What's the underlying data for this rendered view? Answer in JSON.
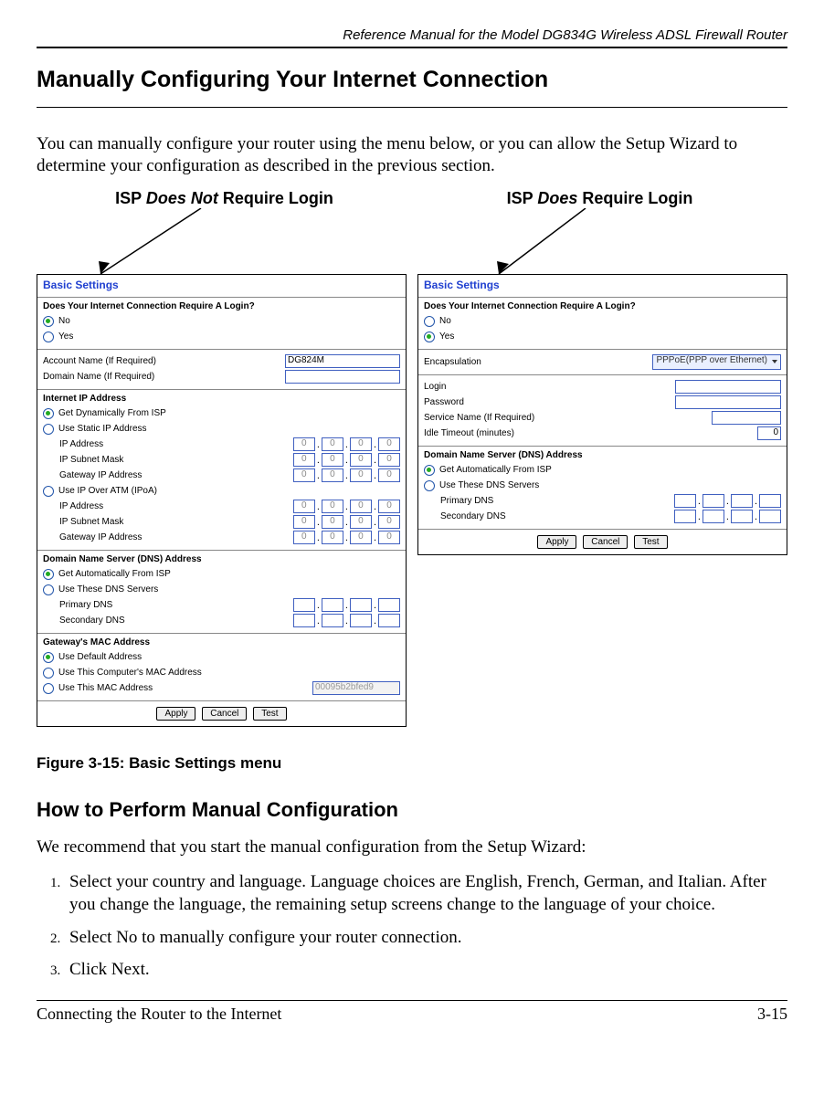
{
  "header": {
    "running_title": "Reference Manual for the Model DG834G Wireless ADSL Firewall Router"
  },
  "h1": "Manually Configuring Your Internet Connection",
  "intro": "You can manually configure your router using the menu below, or you can allow the Setup Wizard to determine your configuration as described in the previous section.",
  "callouts": {
    "left_pre": "ISP ",
    "left_em": "Does Not",
    "left_post": " Require Login",
    "right_pre": "ISP ",
    "right_em": "Does",
    "right_post": " Require Login"
  },
  "panel_left": {
    "title": "Basic Settings",
    "q": "Does Your Internet Connection Require A Login?",
    "no": "No",
    "yes": "Yes",
    "account_label": "Account Name  (If Required)",
    "account_value": "DG824M",
    "domain_label": "Domain Name  (If Required)",
    "ip_section": "Internet IP Address",
    "ip_dyn": "Get Dynamically From ISP",
    "ip_static": "Use Static IP Address",
    "ip_addr": "IP Address",
    "ip_mask": "IP Subnet Mask",
    "ip_gw": "Gateway IP Address",
    "ip_atm": "Use IP Over ATM (IPoA)",
    "oct": "0",
    "dns_section": "Domain Name Server (DNS) Address",
    "dns_auto": "Get Automatically From ISP",
    "dns_use": "Use These DNS Servers",
    "dns_pri": "Primary DNS",
    "dns_sec": "Secondary DNS",
    "mac_section": "Gateway's MAC Address",
    "mac_def": "Use Default Address",
    "mac_comp": "Use This Computer's MAC Address",
    "mac_this": "Use This MAC Address",
    "mac_value": "00095b2bfed9",
    "btn_apply": "Apply",
    "btn_cancel": "Cancel",
    "btn_test": "Test"
  },
  "panel_right": {
    "title": "Basic Settings",
    "q": "Does Your Internet Connection Require A Login?",
    "no": "No",
    "yes": "Yes",
    "encap_label": "Encapsulation",
    "encap_value": "PPPoE(PPP over Ethernet)",
    "login_label": "Login",
    "password_label": "Password",
    "service_label": "Service Name  (If Required)",
    "idle_label": "Idle Timeout (minutes)",
    "idle_value": "0",
    "dns_section": "Domain Name Server (DNS) Address",
    "dns_auto": "Get Automatically From ISP",
    "dns_use": "Use These DNS Servers",
    "dns_pri": "Primary DNS",
    "dns_sec": "Secondary DNS",
    "btn_apply": "Apply",
    "btn_cancel": "Cancel",
    "btn_test": "Test"
  },
  "figure_caption": "Figure 3-15:  Basic Settings menu",
  "h2": "How to Perform Manual Configuration",
  "h2_intro": "We recommend that you start the manual configuration from the Setup Wizard:",
  "steps": {
    "s1": "Select your country and language. Language choices are English, French, German, and Italian. After you change the language, the remaining setup screens change to the language of your choice.",
    "s2": "Select No to manually configure your router connection.",
    "s3": "Click Next."
  },
  "footer": {
    "left": "Connecting the Router to the Internet",
    "right": "3-15"
  }
}
